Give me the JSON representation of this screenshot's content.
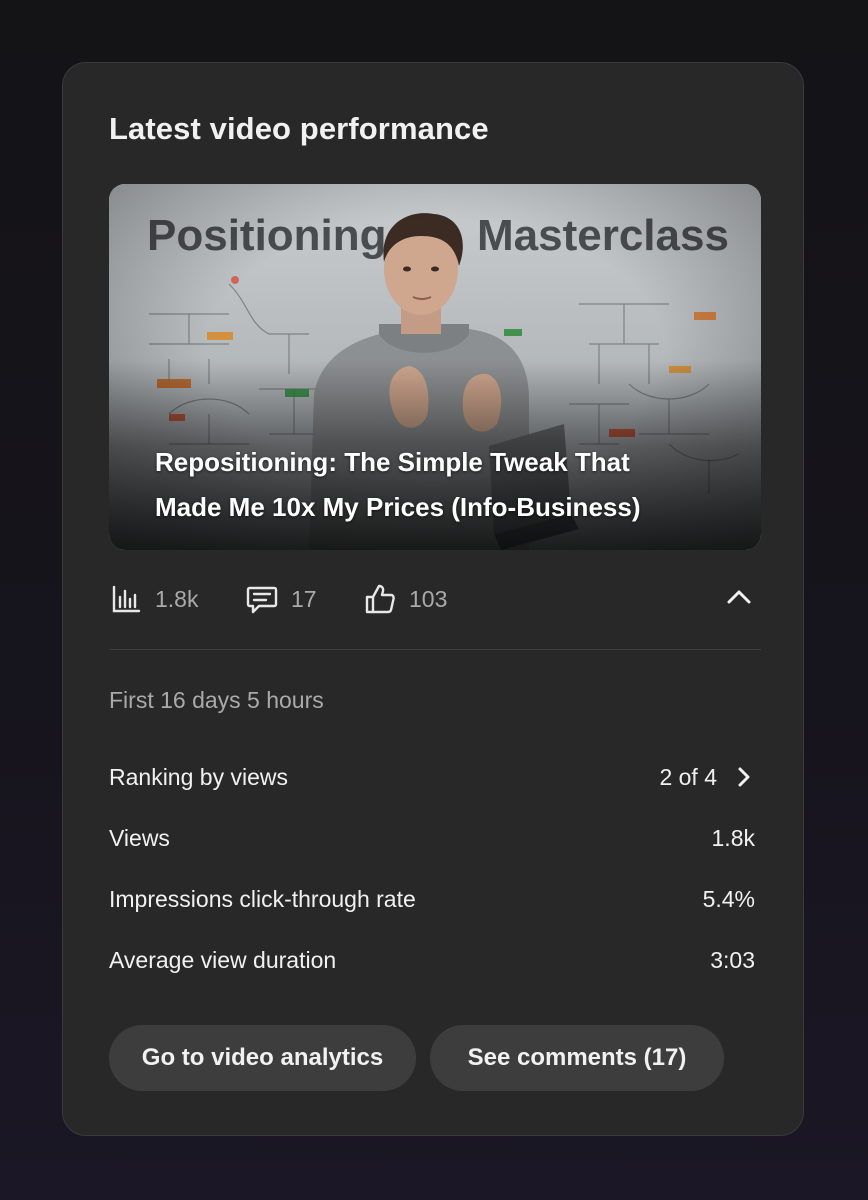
{
  "card": {
    "title": "Latest video performance"
  },
  "video": {
    "thumbnail_text": "Positioning Masterclass",
    "title_line1": "Repositioning: The Simple Tweak That",
    "title_line2": "Made Me 10x My Prices (Info-Business)"
  },
  "stats": {
    "views_icon": "bar-chart-icon",
    "views": "1.8k",
    "comments_icon": "comment-icon",
    "comments": "17",
    "likes_icon": "thumbs-up-icon",
    "likes": "103",
    "collapse_icon": "chevron-up-icon"
  },
  "details": {
    "period": "First 16 days 5 hours",
    "rows": [
      {
        "label": "Ranking by views",
        "value": "2 of 4"
      },
      {
        "label": "Views",
        "value": "1.8k"
      },
      {
        "label": "Impressions click-through rate",
        "value": "5.4%"
      },
      {
        "label": "Average view duration",
        "value": "3:03"
      }
    ]
  },
  "actions": {
    "analytics_label": "Go to video analytics",
    "comments_label": "See comments (17)"
  },
  "colors": {
    "card_background": "#282828",
    "button_background": "#3d3d3d",
    "secondary_text": "#aaaaaa",
    "primary_text": "#f1f1f1"
  }
}
